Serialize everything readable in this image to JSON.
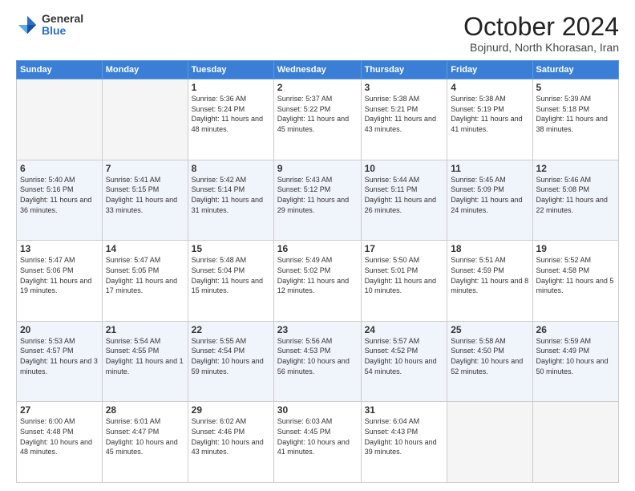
{
  "logo": {
    "general": "General",
    "blue": "Blue"
  },
  "header": {
    "month": "October 2024",
    "location": "Bojnurd, North Khorasan, Iran"
  },
  "days_of_week": [
    "Sunday",
    "Monday",
    "Tuesday",
    "Wednesday",
    "Thursday",
    "Friday",
    "Saturday"
  ],
  "weeks": [
    [
      {
        "num": "",
        "sunrise": "",
        "sunset": "",
        "daylight": "",
        "empty": true
      },
      {
        "num": "",
        "sunrise": "",
        "sunset": "",
        "daylight": "",
        "empty": true
      },
      {
        "num": "1",
        "sunrise": "Sunrise: 5:36 AM",
        "sunset": "Sunset: 5:24 PM",
        "daylight": "Daylight: 11 hours and 48 minutes."
      },
      {
        "num": "2",
        "sunrise": "Sunrise: 5:37 AM",
        "sunset": "Sunset: 5:22 PM",
        "daylight": "Daylight: 11 hours and 45 minutes."
      },
      {
        "num": "3",
        "sunrise": "Sunrise: 5:38 AM",
        "sunset": "Sunset: 5:21 PM",
        "daylight": "Daylight: 11 hours and 43 minutes."
      },
      {
        "num": "4",
        "sunrise": "Sunrise: 5:38 AM",
        "sunset": "Sunset: 5:19 PM",
        "daylight": "Daylight: 11 hours and 41 minutes."
      },
      {
        "num": "5",
        "sunrise": "Sunrise: 5:39 AM",
        "sunset": "Sunset: 5:18 PM",
        "daylight": "Daylight: 11 hours and 38 minutes."
      }
    ],
    [
      {
        "num": "6",
        "sunrise": "Sunrise: 5:40 AM",
        "sunset": "Sunset: 5:16 PM",
        "daylight": "Daylight: 11 hours and 36 minutes."
      },
      {
        "num": "7",
        "sunrise": "Sunrise: 5:41 AM",
        "sunset": "Sunset: 5:15 PM",
        "daylight": "Daylight: 11 hours and 33 minutes."
      },
      {
        "num": "8",
        "sunrise": "Sunrise: 5:42 AM",
        "sunset": "Sunset: 5:14 PM",
        "daylight": "Daylight: 11 hours and 31 minutes."
      },
      {
        "num": "9",
        "sunrise": "Sunrise: 5:43 AM",
        "sunset": "Sunset: 5:12 PM",
        "daylight": "Daylight: 11 hours and 29 minutes."
      },
      {
        "num": "10",
        "sunrise": "Sunrise: 5:44 AM",
        "sunset": "Sunset: 5:11 PM",
        "daylight": "Daylight: 11 hours and 26 minutes."
      },
      {
        "num": "11",
        "sunrise": "Sunrise: 5:45 AM",
        "sunset": "Sunset: 5:09 PM",
        "daylight": "Daylight: 11 hours and 24 minutes."
      },
      {
        "num": "12",
        "sunrise": "Sunrise: 5:46 AM",
        "sunset": "Sunset: 5:08 PM",
        "daylight": "Daylight: 11 hours and 22 minutes."
      }
    ],
    [
      {
        "num": "13",
        "sunrise": "Sunrise: 5:47 AM",
        "sunset": "Sunset: 5:06 PM",
        "daylight": "Daylight: 11 hours and 19 minutes."
      },
      {
        "num": "14",
        "sunrise": "Sunrise: 5:47 AM",
        "sunset": "Sunset: 5:05 PM",
        "daylight": "Daylight: 11 hours and 17 minutes."
      },
      {
        "num": "15",
        "sunrise": "Sunrise: 5:48 AM",
        "sunset": "Sunset: 5:04 PM",
        "daylight": "Daylight: 11 hours and 15 minutes."
      },
      {
        "num": "16",
        "sunrise": "Sunrise: 5:49 AM",
        "sunset": "Sunset: 5:02 PM",
        "daylight": "Daylight: 11 hours and 12 minutes."
      },
      {
        "num": "17",
        "sunrise": "Sunrise: 5:50 AM",
        "sunset": "Sunset: 5:01 PM",
        "daylight": "Daylight: 11 hours and 10 minutes."
      },
      {
        "num": "18",
        "sunrise": "Sunrise: 5:51 AM",
        "sunset": "Sunset: 4:59 PM",
        "daylight": "Daylight: 11 hours and 8 minutes."
      },
      {
        "num": "19",
        "sunrise": "Sunrise: 5:52 AM",
        "sunset": "Sunset: 4:58 PM",
        "daylight": "Daylight: 11 hours and 5 minutes."
      }
    ],
    [
      {
        "num": "20",
        "sunrise": "Sunrise: 5:53 AM",
        "sunset": "Sunset: 4:57 PM",
        "daylight": "Daylight: 11 hours and 3 minutes."
      },
      {
        "num": "21",
        "sunrise": "Sunrise: 5:54 AM",
        "sunset": "Sunset: 4:55 PM",
        "daylight": "Daylight: 11 hours and 1 minute."
      },
      {
        "num": "22",
        "sunrise": "Sunrise: 5:55 AM",
        "sunset": "Sunset: 4:54 PM",
        "daylight": "Daylight: 10 hours and 59 minutes."
      },
      {
        "num": "23",
        "sunrise": "Sunrise: 5:56 AM",
        "sunset": "Sunset: 4:53 PM",
        "daylight": "Daylight: 10 hours and 56 minutes."
      },
      {
        "num": "24",
        "sunrise": "Sunrise: 5:57 AM",
        "sunset": "Sunset: 4:52 PM",
        "daylight": "Daylight: 10 hours and 54 minutes."
      },
      {
        "num": "25",
        "sunrise": "Sunrise: 5:58 AM",
        "sunset": "Sunset: 4:50 PM",
        "daylight": "Daylight: 10 hours and 52 minutes."
      },
      {
        "num": "26",
        "sunrise": "Sunrise: 5:59 AM",
        "sunset": "Sunset: 4:49 PM",
        "daylight": "Daylight: 10 hours and 50 minutes."
      }
    ],
    [
      {
        "num": "27",
        "sunrise": "Sunrise: 6:00 AM",
        "sunset": "Sunset: 4:48 PM",
        "daylight": "Daylight: 10 hours and 48 minutes."
      },
      {
        "num": "28",
        "sunrise": "Sunrise: 6:01 AM",
        "sunset": "Sunset: 4:47 PM",
        "daylight": "Daylight: 10 hours and 45 minutes."
      },
      {
        "num": "29",
        "sunrise": "Sunrise: 6:02 AM",
        "sunset": "Sunset: 4:46 PM",
        "daylight": "Daylight: 10 hours and 43 minutes."
      },
      {
        "num": "30",
        "sunrise": "Sunrise: 6:03 AM",
        "sunset": "Sunset: 4:45 PM",
        "daylight": "Daylight: 10 hours and 41 minutes."
      },
      {
        "num": "31",
        "sunrise": "Sunrise: 6:04 AM",
        "sunset": "Sunset: 4:43 PM",
        "daylight": "Daylight: 10 hours and 39 minutes."
      },
      {
        "num": "",
        "sunrise": "",
        "sunset": "",
        "daylight": "",
        "empty": true
      },
      {
        "num": "",
        "sunrise": "",
        "sunset": "",
        "daylight": "",
        "empty": true
      }
    ]
  ]
}
